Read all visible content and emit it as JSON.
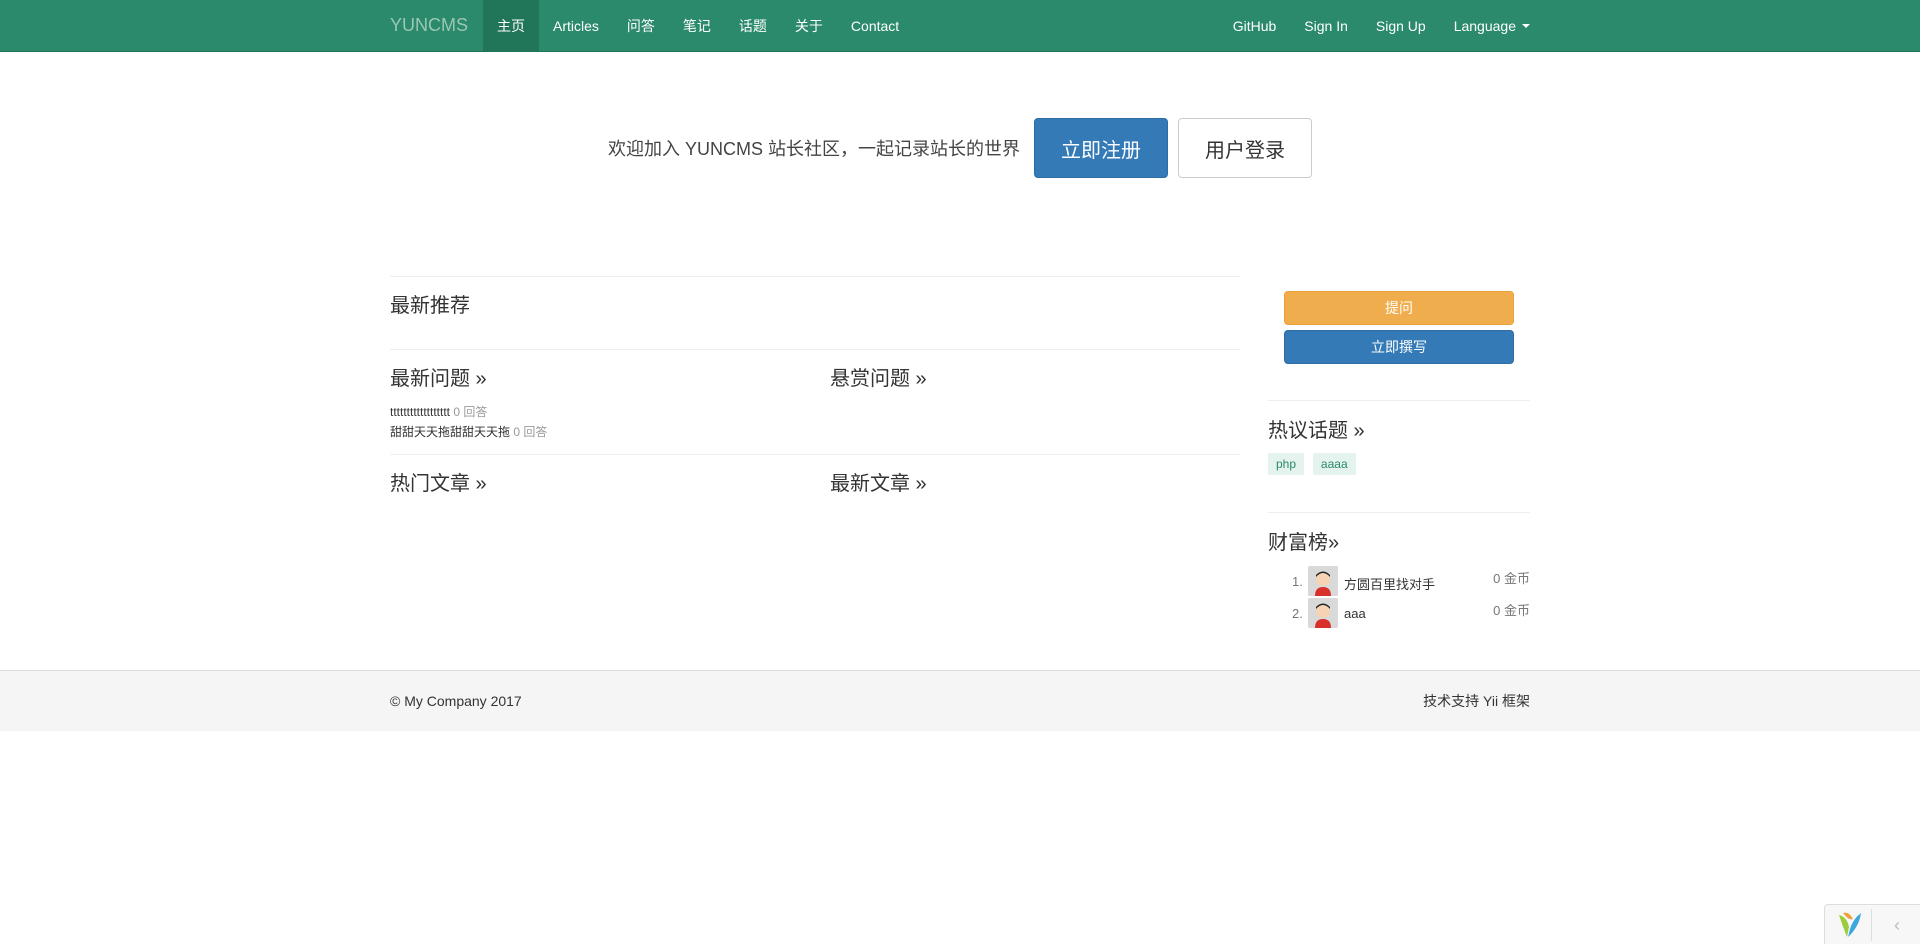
{
  "navbar": {
    "brand": "YUNCMS",
    "left": [
      "主页",
      "Articles",
      "问答",
      "笔记",
      "话题",
      "关于",
      "Contact"
    ],
    "right": [
      "GitHub",
      "Sign In",
      "Sign Up",
      "Language"
    ]
  },
  "jumbotron": {
    "text": "欢迎加入 YUNCMS 站长社区，一起记录站长的世界",
    "register": "立即注册",
    "login": "用户登录"
  },
  "main": {
    "recommend_title": "最新推荐",
    "latest_questions_title": "最新问题 »",
    "reward_questions_title": "悬赏问题 »",
    "questions": [
      {
        "title": "tttttttttttttttttt",
        "answers": "0 回答"
      },
      {
        "title": "甜甜天天拖甜甜天天拖",
        "answers": "0 回答"
      }
    ],
    "hot_articles_title": "热门文章 »",
    "latest_articles_title": "最新文章 »"
  },
  "sidebar": {
    "ask_label": "提问",
    "write_label": "立即撰写",
    "hot_topics_title": "热议话题 »",
    "tags": [
      "php",
      "aaaa"
    ],
    "wealth_title": "财富榜»",
    "ranking": [
      {
        "rank": "1.",
        "name": "方圆百里找对手",
        "coins": "0 金币"
      },
      {
        "rank": "2.",
        "name": "aaa",
        "coins": "0 金币"
      }
    ]
  },
  "footer": {
    "copyright": "© My Company 2017",
    "powered": "技术支持 Yii 框架"
  },
  "colors": {
    "navbar_bg": "#2a8a6b",
    "primary": "#337ab7",
    "warning": "#f0ad4e"
  },
  "icons": [
    "caret-down-icon",
    "avatar-icon",
    "yii-logo-icon",
    "chevron-left-icon"
  ]
}
